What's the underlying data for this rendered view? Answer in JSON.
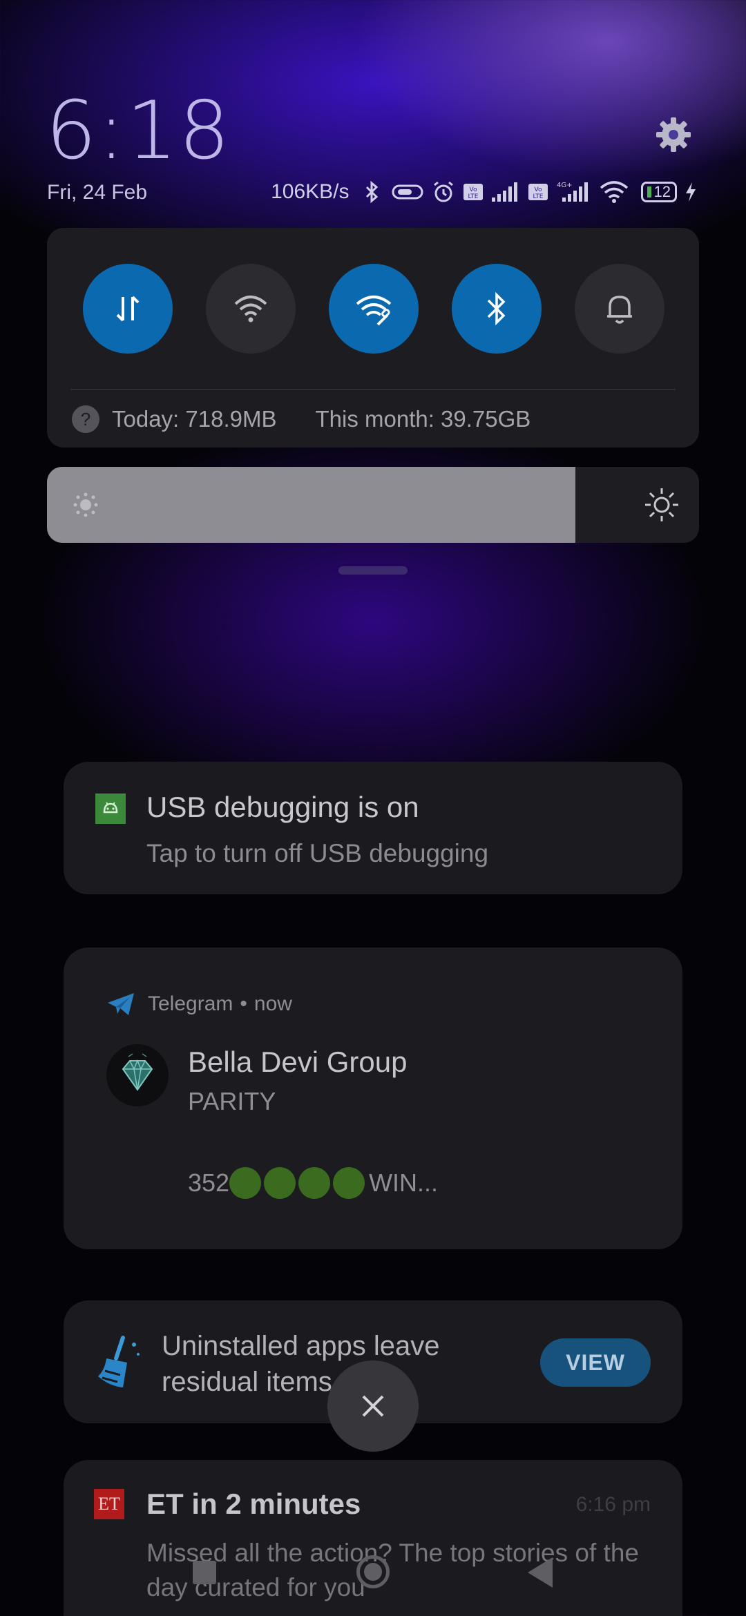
{
  "status": {
    "time": "6:18",
    "date": "Fri, 24 Feb",
    "network_speed": "106KB/s",
    "battery_level": "12",
    "icons": [
      "bluetooth-icon",
      "vpn-key-icon",
      "alarm-icon",
      "volte-icon",
      "signal-icon",
      "volte-icon",
      "4g-signal-icon",
      "wifi-icon",
      "battery-icon",
      "charging-icon"
    ]
  },
  "quick_settings": {
    "toggles": [
      {
        "name": "mobile-data",
        "icon": "data-transfer-icon",
        "state": "on"
      },
      {
        "name": "wifi",
        "icon": "wifi-icon",
        "state": "off"
      },
      {
        "name": "hotspot",
        "icon": "wifi-link-icon",
        "state": "on"
      },
      {
        "name": "bluetooth",
        "icon": "bluetooth-icon",
        "state": "on"
      },
      {
        "name": "ringer",
        "icon": "bell-icon",
        "state": "off"
      }
    ],
    "usage_today": "Today: 718.9MB",
    "usage_month": "This month: 39.75GB",
    "help_glyph": "?"
  },
  "brightness": {
    "level_percent": 81
  },
  "notifications": {
    "usb": {
      "title": "USB debugging is on",
      "text": "Tap to turn off USB debugging"
    },
    "telegram": {
      "app": "Telegram",
      "time": "now",
      "separator": "•",
      "title": "Bella Devi Group",
      "subtitle": "PARITY",
      "message_prefix": "352",
      "message_suffix": "WIN..."
    },
    "cleaner": {
      "text": "Uninstalled apps leave residual items",
      "button": "VIEW"
    },
    "et": {
      "logo": "ET",
      "title": "ET in 2 minutes",
      "time": "6:16 pm",
      "text": "Missed all the action? The top stories of the day curated for you"
    }
  },
  "colors": {
    "accent_blue": "#0b6aaf",
    "card_bg": "#1d1c20",
    "view_button": "#17527d"
  }
}
